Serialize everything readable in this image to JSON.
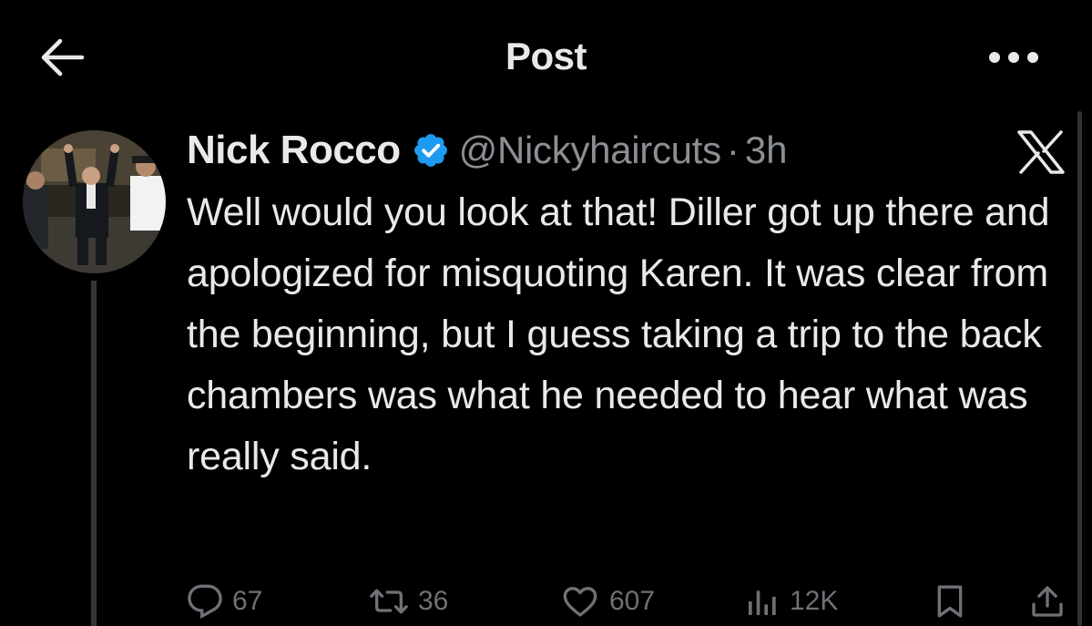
{
  "header": {
    "title": "Post",
    "back_icon": "arrow-left-icon",
    "more_icon": "more-dots-icon"
  },
  "tweet": {
    "display_name": "Nick Rocco",
    "verified": true,
    "handle": "@Nickyhaircuts",
    "separator": "·",
    "time": "3h",
    "text": "Well would you look at that! Diller got up there and apologized for misquoting Karen. It was clear from the beginning, but I guess taking a trip to the back chambers was what he needed to hear what was really said.",
    "brand_icon": "x-logo-icon"
  },
  "actions": {
    "replies": "67",
    "reposts": "36",
    "likes": "607",
    "views": "12K"
  },
  "colors": {
    "background": "#000000",
    "text": "#e7e9ea",
    "secondary": "#8b8f93",
    "action": "#6e7276",
    "verified": "#1d9bf0"
  }
}
